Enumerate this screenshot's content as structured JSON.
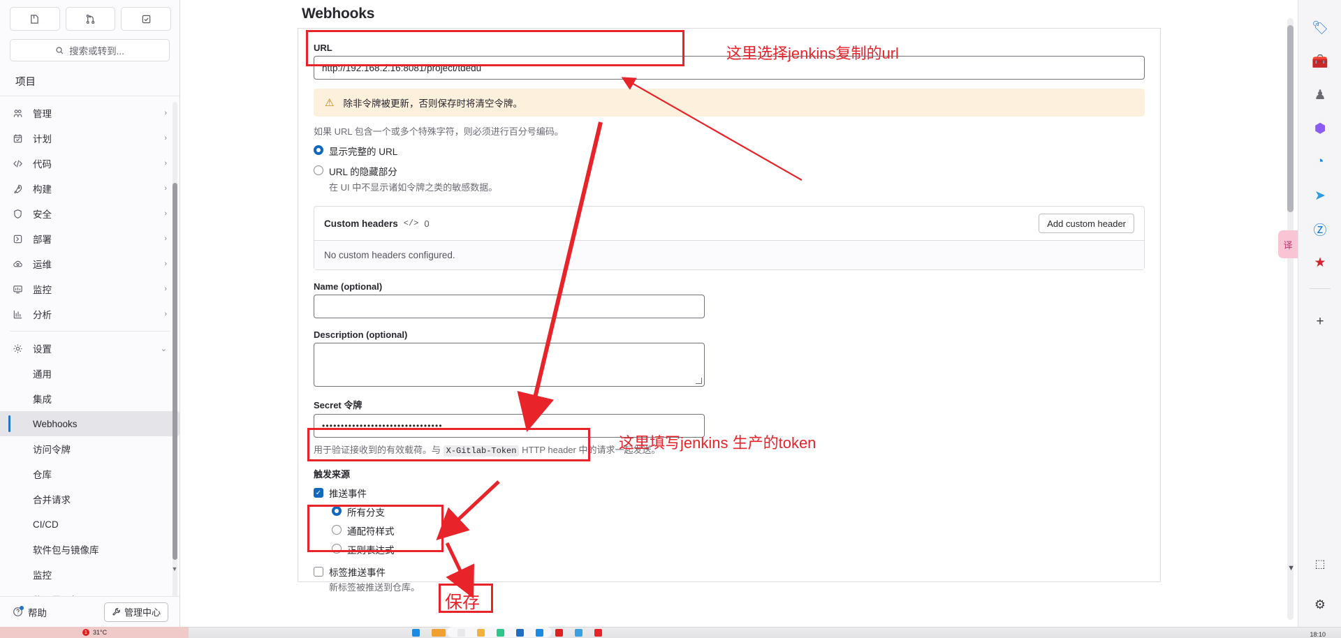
{
  "sidebar": {
    "top_buttons": [
      {
        "name": "issues-button",
        "glyph": "◧"
      },
      {
        "name": "merge-requests-button",
        "glyph": "⌥"
      },
      {
        "name": "todos-button",
        "glyph": "☑"
      }
    ],
    "search_placeholder": "搜索或转到...",
    "search_icon": "search-icon",
    "section_title": "项目",
    "nav_items": [
      {
        "label": "管理",
        "icon": "users-icon",
        "chevron": "›"
      },
      {
        "label": "计划",
        "icon": "calendar-icon",
        "chevron": "›"
      },
      {
        "label": "代码",
        "icon": "code-icon",
        "chevron": "›"
      },
      {
        "label": "构建",
        "icon": "rocket-icon",
        "chevron": "›"
      },
      {
        "label": "安全",
        "icon": "shield-icon",
        "chevron": "›"
      },
      {
        "label": "部署",
        "icon": "deploy-icon",
        "chevron": "›"
      },
      {
        "label": "运维",
        "icon": "cloud-gear-icon",
        "chevron": "›"
      },
      {
        "label": "监控",
        "icon": "monitor-icon",
        "chevron": "›"
      },
      {
        "label": "分析",
        "icon": "chart-icon",
        "chevron": "›"
      }
    ],
    "settings": {
      "label": "设置",
      "icon": "gear-icon",
      "chevron": "⌄"
    },
    "settings_children": [
      "通用",
      "集成",
      "Webhooks",
      "访问令牌",
      "仓库",
      "合并请求",
      "CI/CD",
      "软件包与镜像库",
      "监控",
      "使用量配额"
    ],
    "active_child": "Webhooks",
    "footer": {
      "help_label": "帮助",
      "help_icon": "question-circle-icon",
      "admin_label": "管理中心",
      "admin_icon": "wrench-icon"
    }
  },
  "main": {
    "page_title": "Webhooks",
    "url": {
      "label": "URL",
      "value": "http://192.168.2.16:8081/project/tdedu"
    },
    "warning": {
      "icon": "warning-triangle-icon",
      "text": "除非令牌被更新，否则保存时将清空令牌。"
    },
    "url_help": "如果 URL 包含一个或多个特殊字符，则必须进行百分号编码。",
    "url_radios": [
      {
        "label": "显示完整的 URL",
        "selected": true,
        "help": ""
      },
      {
        "label": "URL 的隐藏部分",
        "selected": false,
        "help": "在 UI 中不显示诸如令牌之类的敏感数据。"
      }
    ],
    "custom_headers": {
      "title": "Custom headers",
      "code_icon": "</>",
      "count": "0",
      "add_button": "Add custom header",
      "empty_text": "No custom headers configured."
    },
    "name_field": {
      "label": "Name (optional)",
      "value": ""
    },
    "description_field": {
      "label": "Description (optional)",
      "value": ""
    },
    "secret_token": {
      "label": "Secret 令牌",
      "value": "••••••••••••••••••••••••••••••••",
      "help_prefix": "用于验证接收到的有效载荷。与 ",
      "help_chip": "X-Gitlab-Token",
      "help_suffix": " HTTP header 中的请求一起发送。"
    },
    "trigger_section": {
      "title": "触发来源",
      "push_events": {
        "label": "推送事件",
        "checked": true
      },
      "branch_radios": [
        {
          "label": "所有分支",
          "selected": true
        },
        {
          "label": "通配符样式",
          "selected": false
        },
        {
          "label": "正则表达式",
          "selected": false
        }
      ],
      "tag_push": {
        "label": "标签推送事件",
        "checked": false,
        "help": "新标签被推送到仓库。"
      }
    }
  },
  "annotations": [
    {
      "name": "annotation-url",
      "text": "这里选择jenkins复制的url"
    },
    {
      "name": "annotation-token",
      "text": "这里填写jenkins 生产的token"
    },
    {
      "name": "annotation-save",
      "text": "保存"
    }
  ],
  "right_rail": {
    "icons": [
      {
        "name": "tag-icon",
        "glyph": "🏷",
        "color": "#2f7ce8"
      },
      {
        "name": "toolbox-icon",
        "glyph": "🧰",
        "color": "#ef4710"
      },
      {
        "name": "chess-icon",
        "glyph": "♟",
        "color": "#6b6b74"
      },
      {
        "name": "copilot-icon",
        "glyph": "⬢",
        "color": "#8b5cf6"
      },
      {
        "name": "outlook-icon",
        "glyph": "◔",
        "color": "#1b8ae0"
      },
      {
        "name": "telegram-icon",
        "glyph": "➤",
        "color": "#2b9ce6"
      },
      {
        "name": "zhihu-icon",
        "glyph": "Ⓩ",
        "color": "#1677d6"
      },
      {
        "name": "gov-icon",
        "glyph": "★",
        "color": "#d8232a"
      }
    ],
    "add_label": "+",
    "translate_badge": "译",
    "bottom_icons": [
      {
        "name": "screenshot-icon",
        "glyph": "⬚"
      },
      {
        "name": "settings-icon",
        "glyph": "⚙"
      }
    ]
  },
  "taskbar": {
    "weather_temp": "31°C",
    "notification_count": "1",
    "clock_time": "18:10"
  },
  "colors": {
    "accent": "#1f75cb",
    "annotation_red": "#e8232a",
    "warning_bg": "#fdf1dd",
    "active_bg": "#e4e4e9"
  }
}
